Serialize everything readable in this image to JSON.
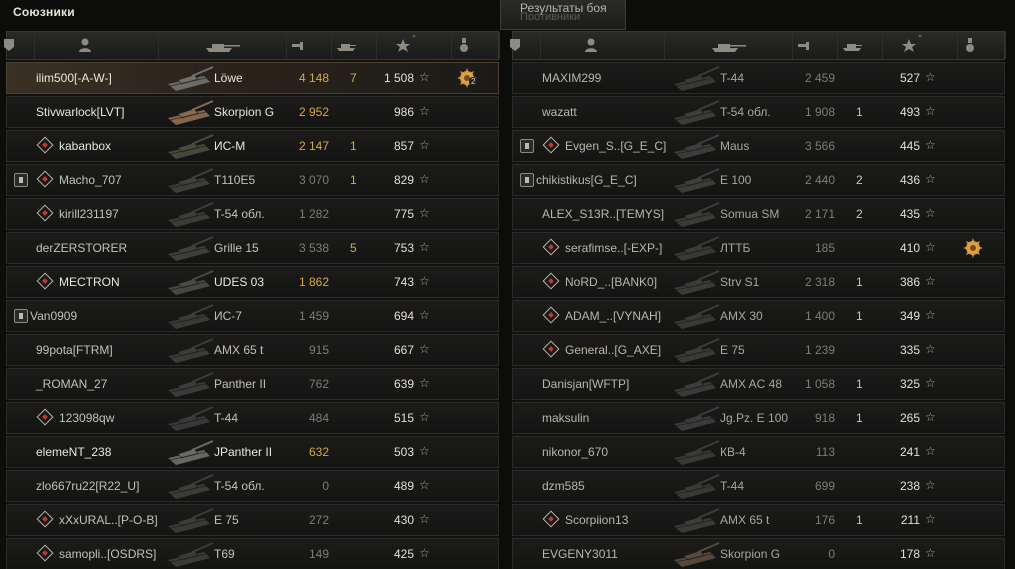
{
  "allies": {
    "title": "Союзники",
    "rows": [
      {
        "badge": false,
        "diamond": false,
        "name": "ilim500[-A-W-]",
        "tank": "Löwe",
        "damage": "4 148",
        "frags": "7",
        "xp": "1 508",
        "highlight": true,
        "medal": true,
        "medal_count": "2",
        "name_color": "#e9e6dc",
        "damage_color": "#d7a942",
        "frags_color": "#d7a942",
        "tank_shade": "#6f6f6c"
      },
      {
        "badge": false,
        "diamond": false,
        "name": "Stivwarlock[LVT]",
        "tank": "Skorpion G",
        "damage": "2 952",
        "frags": "",
        "xp": "986",
        "name_color": "#e9e6dc",
        "damage_color": "#d7a942",
        "tank_shade": "#8a6a4f"
      },
      {
        "badge": false,
        "diamond": true,
        "name": "kabanbox",
        "tank": "ИС-М",
        "damage": "2 147",
        "frags": "1",
        "xp": "857",
        "name_color": "#e9e6dc",
        "damage_color": "#d7a942",
        "frags_color": "#d7a942",
        "tank_shade": "#4b4a3e"
      },
      {
        "badge": true,
        "diamond": true,
        "name": "Macho_707",
        "tank": "T110E5",
        "damage": "3 070",
        "frags": "1",
        "xp": "829",
        "name_color": "#c3c0b6",
        "damage_color": "#7f7c75",
        "frags_color": "#d7a942",
        "tank_shade": "#3f403c"
      },
      {
        "badge": false,
        "diamond": true,
        "name": "kirill231197",
        "tank": "T-54 обл.",
        "damage": "1 282",
        "frags": "",
        "xp": "775",
        "name_color": "#c3c0b6",
        "damage_color": "#7f7c75",
        "tank_shade": "#3c3f39"
      },
      {
        "badge": false,
        "diamond": false,
        "name": "derZERSTORER",
        "tank": "Grille 15",
        "damage": "3 538",
        "frags": "5",
        "xp": "753",
        "name_color": "#c3c0b6",
        "damage_color": "#7f7c75",
        "frags_color": "#d7a942",
        "tank_shade": "#3f413f"
      },
      {
        "badge": false,
        "diamond": true,
        "name": "MECTRON",
        "tank": "UDES 03",
        "damage": "1 862",
        "frags": "",
        "xp": "743",
        "name_color": "#e9e6dc",
        "damage_color": "#d7a942",
        "tank_shade": "#4a4a45"
      },
      {
        "badge": true,
        "diamond": false,
        "name": "Van0909",
        "tank": "ИС-7",
        "damage": "1 459",
        "frags": "",
        "xp": "694",
        "name_color": "#c3c0b6",
        "damage_color": "#7f7c75",
        "tank_shade": "#3b3c3a"
      },
      {
        "badge": false,
        "diamond": false,
        "name": "99pota[FTRM]",
        "tank": "AMX 65 t",
        "damage": "915",
        "frags": "",
        "xp": "667",
        "name_color": "#c3c0b6",
        "damage_color": "#7f7c75",
        "tank_shade": "#3c3d3b"
      },
      {
        "badge": false,
        "diamond": false,
        "name": "_ROMAN_27",
        "tank": "Panther II",
        "damage": "762",
        "frags": "",
        "xp": "639",
        "name_color": "#c3c0b6",
        "damage_color": "#7f7c75",
        "tank_shade": "#3c3d3b"
      },
      {
        "badge": false,
        "diamond": true,
        "name": "123098qw",
        "tank": "T-44",
        "damage": "484",
        "frags": "",
        "xp": "515",
        "name_color": "#c3c0b6",
        "damage_color": "#7f7c75",
        "tank_shade": "#3a3b39"
      },
      {
        "badge": false,
        "diamond": false,
        "name": "elemeNT_238",
        "tank": "JPanther II",
        "damage": "632",
        "frags": "",
        "xp": "503",
        "name_color": "#e9e6dc",
        "damage_color": "#d7a942",
        "tank_shade": "#6a6a66"
      },
      {
        "badge": false,
        "diamond": false,
        "name": "zlo667ru22[R22_U]",
        "tank": "T-54 обл.",
        "damage": "0",
        "frags": "",
        "xp": "489",
        "name_color": "#c3c0b6",
        "damage_color": "#7f7c75",
        "tank_shade": "#3c3f39"
      },
      {
        "badge": false,
        "diamond": true,
        "name": "xXxURAL..[P-O-B]",
        "tank": "E 75",
        "damage": "272",
        "frags": "",
        "xp": "430",
        "name_color": "#c3c0b6",
        "damage_color": "#7f7c75",
        "tank_shade": "#3b3c3a"
      },
      {
        "badge": false,
        "diamond": true,
        "name": "samopli..[OSDRS]",
        "tank": "T69",
        "damage": "149",
        "frags": "",
        "xp": "425",
        "name_color": "#c3c0b6",
        "damage_color": "#7f7c75",
        "tank_shade": "#3b3c3a"
      }
    ]
  },
  "enemies": {
    "title": "Противники",
    "rows": [
      {
        "badge": false,
        "diamond": false,
        "name": "MAXIM299",
        "tank": "T-44",
        "damage": "2 459",
        "frags": "",
        "xp": "527",
        "tank_shade": "#3a3b39"
      },
      {
        "badge": false,
        "diamond": false,
        "name": "wazatt",
        "tank": "T-54 обл.",
        "damage": "1 908",
        "frags": "1",
        "xp": "493",
        "tank_shade": "#3c3f39"
      },
      {
        "badge": true,
        "diamond": true,
        "name": "Evgen_S..[G_E_C]",
        "tank": "Maus",
        "damage": "3 566",
        "frags": "",
        "xp": "445",
        "tank_shade": "#3e3f3d"
      },
      {
        "badge": true,
        "diamond": false,
        "name": "chikistikus[G_E_C]",
        "tank": "E 100",
        "damage": "2 440",
        "frags": "2",
        "xp": "436",
        "tank_shade": "#3e3f3d"
      },
      {
        "badge": false,
        "diamond": false,
        "name": "ALEX_S13R..[TEMYS]",
        "tank": "Somua SM",
        "damage": "2 171",
        "frags": "2",
        "xp": "435",
        "tank_shade": "#3c3d3b"
      },
      {
        "badge": false,
        "diamond": true,
        "name": "serafimse..[-EXP-]",
        "tank": "ЛТТБ",
        "damage": "185",
        "frags": "",
        "xp": "410",
        "medal": true,
        "tank_shade": "#3a3b39"
      },
      {
        "badge": false,
        "diamond": true,
        "name": "NoRD_..[BANK0]",
        "tank": "Strv S1",
        "damage": "2 318",
        "frags": "1",
        "xp": "386",
        "tank_shade": "#3c3d3b"
      },
      {
        "badge": false,
        "diamond": true,
        "name": "ADAM_..[VYNAH]",
        "tank": "AMX 30",
        "damage": "1 400",
        "frags": "1",
        "xp": "349",
        "tank_shade": "#3a3b39"
      },
      {
        "badge": false,
        "diamond": true,
        "name": "General..[G_AXE]",
        "tank": "E 75",
        "damage": "1 239",
        "frags": "",
        "xp": "335",
        "tank_shade": "#3b3c3a"
      },
      {
        "badge": false,
        "diamond": false,
        "name": "Danisjan[WFTP]",
        "tank": "AMX AC 48",
        "damage": "1 058",
        "frags": "1",
        "xp": "325",
        "tank_shade": "#3c3d3b"
      },
      {
        "badge": false,
        "diamond": false,
        "name": "maksulin",
        "tank": "Jg.Pz. E 100",
        "damage": "918",
        "frags": "1",
        "xp": "265",
        "tank_shade": "#3c3d3b"
      },
      {
        "badge": false,
        "diamond": false,
        "name": "nikonor_670",
        "tank": "КВ-4",
        "damage": "113",
        "frags": "",
        "xp": "241",
        "tank_shade": "#3a3b39"
      },
      {
        "badge": false,
        "diamond": false,
        "name": "dzm585",
        "tank": "T-44",
        "damage": "699",
        "frags": "",
        "xp": "238",
        "tank_shade": "#3a3b39"
      },
      {
        "badge": false,
        "diamond": true,
        "name": "Scorpiion13",
        "tank": "AMX 65 t",
        "damage": "176",
        "frags": "1",
        "xp": "211",
        "tank_shade": "#3c3d3b"
      },
      {
        "badge": false,
        "diamond": false,
        "name": "EVGENY3011",
        "tank": "Skorpion G",
        "damage": "0",
        "frags": "",
        "xp": "178",
        "tank_shade": "#5a4a3c"
      }
    ]
  },
  "tooltip": {
    "text": "Результаты боя"
  },
  "star_glyph": "☆",
  "colors": {
    "gold": "#d7a942",
    "enemy_name": "#b9b6ac",
    "enemy_damage": "#7f7c75",
    "enemy_frags": "#c9c6bd"
  }
}
